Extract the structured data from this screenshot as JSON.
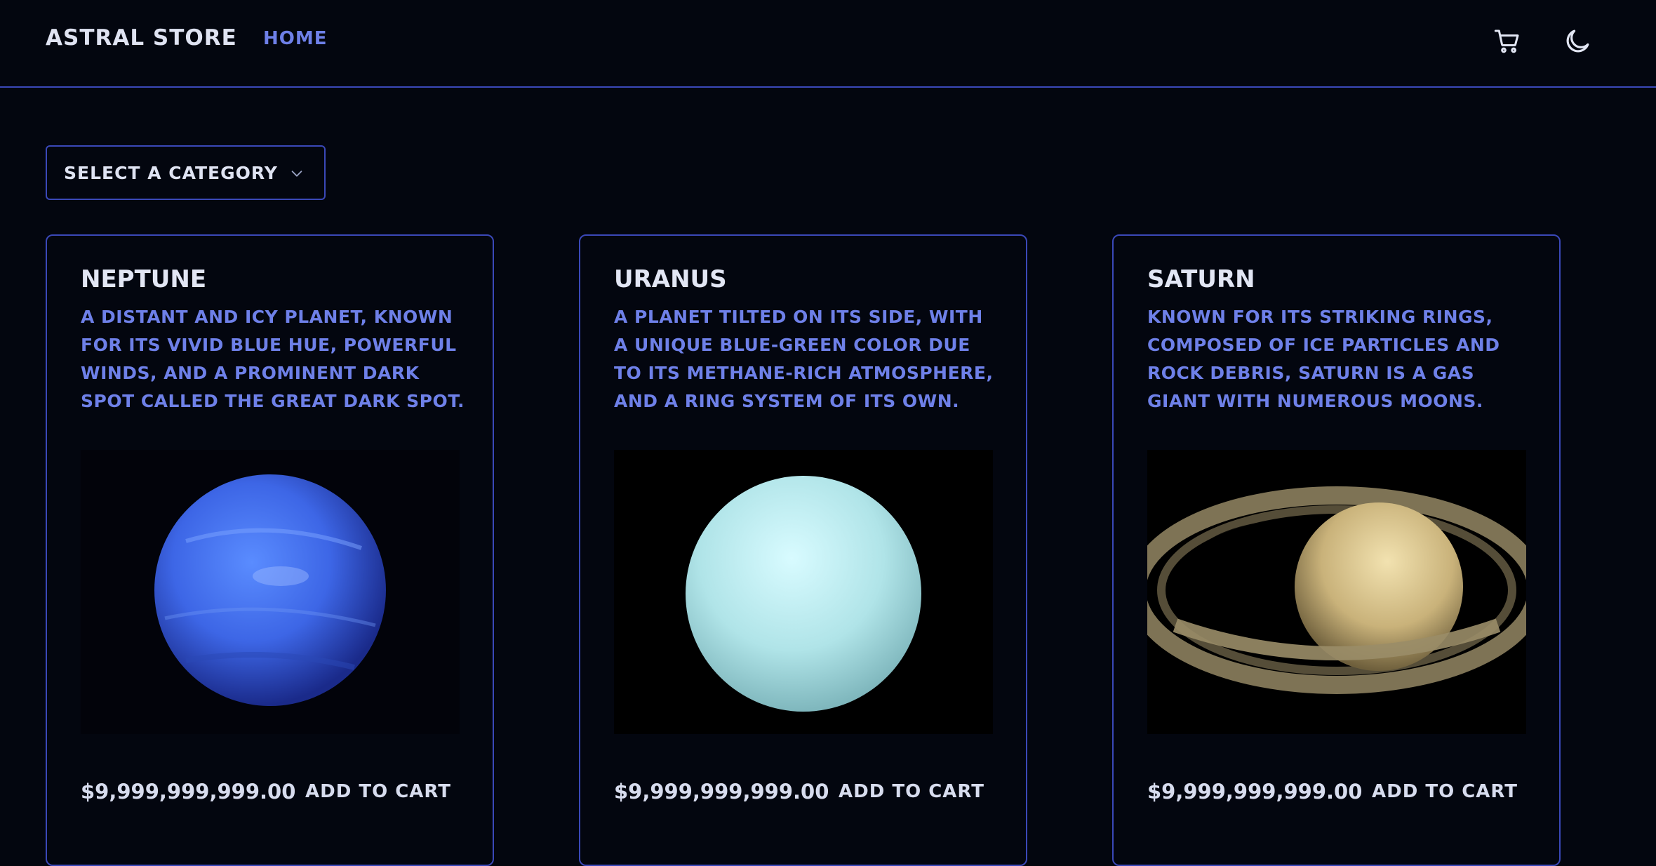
{
  "header": {
    "brand": "ASTRAL STORE",
    "nav_home": "HOME",
    "cart_icon": "cart-icon",
    "theme_icon": "moon-icon"
  },
  "filter": {
    "category_select_label": "SELECT A CATEGORY",
    "chevron_icon": "chevron-down-icon"
  },
  "products": [
    {
      "name": "NEPTUNE",
      "description": "A DISTANT AND ICY PLANET, KNOWN FOR ITS VIVID BLUE HUE, POWERFUL WINDS, AND A PROMINENT DARK SPOT CALLED THE GREAT DARK SPOT.",
      "price": "$9,999,999,999.00",
      "add_to_cart": "ADD TO CART"
    },
    {
      "name": "URANUS",
      "description": "A PLANET TILTED ON ITS SIDE, WITH A UNIQUE BLUE-GREEN COLOR DUE TO ITS METHANE-RICH ATMOSPHERE, AND A RING SYSTEM OF ITS OWN.",
      "price": "$9,999,999,999.00",
      "add_to_cart": "ADD TO CART"
    },
    {
      "name": "SATURN",
      "description": "KNOWN FOR ITS STRIKING RINGS, COMPOSED OF ICE PARTICLES AND ROCK DEBRIS, SATURN IS A GAS GIANT WITH NUMEROUS MOONS.",
      "price": "$9,999,999,999.00",
      "add_to_cart": "ADD TO CART"
    }
  ],
  "colors": {
    "background": "#03060f",
    "border_accent": "#3a48b8",
    "link_accent": "#6e80e8",
    "text_primary": "#dfe3f2"
  }
}
